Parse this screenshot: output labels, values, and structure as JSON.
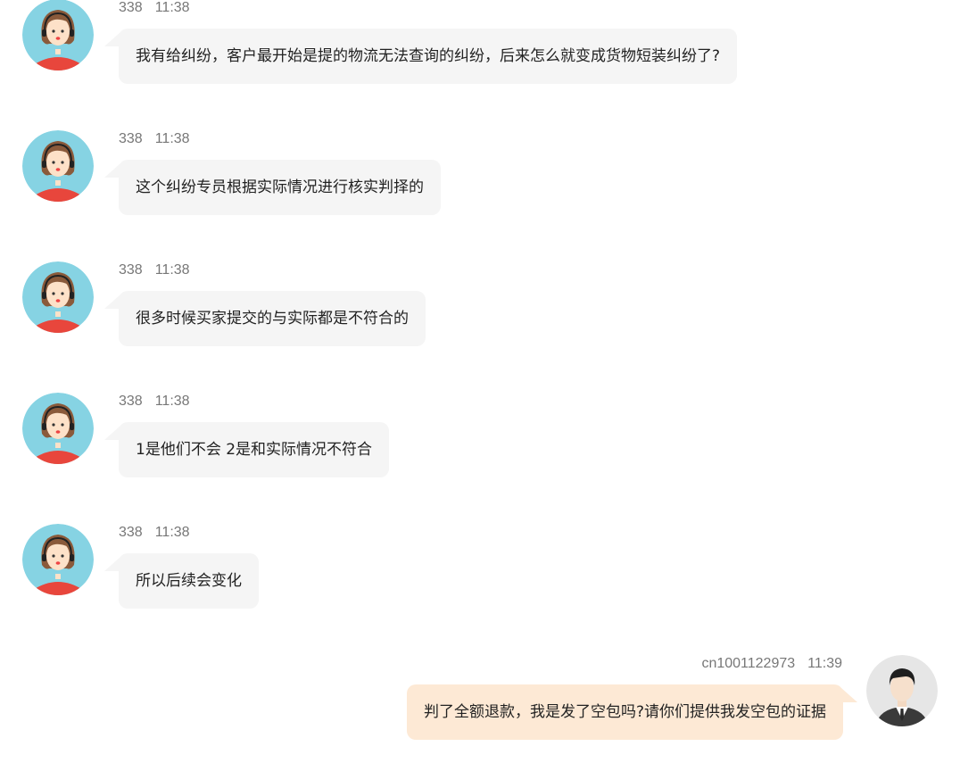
{
  "messages": [
    {
      "role": "agent",
      "sender": "338",
      "time": "11:38",
      "text": "我有给纠纷，客户最开始是提的物流无法查询的纠纷，后来怎么就变成货物短装纠纷了?",
      "avatar": "agent-avatar-icon"
    },
    {
      "role": "agent",
      "sender": "338",
      "time": "11:38",
      "text": "这个纠纷专员根据实际情况进行核实判择的",
      "avatar": "agent-avatar-icon"
    },
    {
      "role": "agent",
      "sender": "338",
      "time": "11:38",
      "text": "很多时候买家提交的与实际都是不符合的",
      "avatar": "agent-avatar-icon"
    },
    {
      "role": "agent",
      "sender": "338",
      "time": "11:38",
      "text": "1是他们不会 2是和实际情况不符合",
      "avatar": "agent-avatar-icon"
    },
    {
      "role": "agent",
      "sender": "338",
      "time": "11:38",
      "text": "所以后续会变化",
      "avatar": "agent-avatar-icon"
    },
    {
      "role": "user",
      "sender": "cn1001122973",
      "time": "11:39",
      "text": "判了全额退款，我是发了空包吗?请你们提供我发空包的证据",
      "avatar": "user-avatar-icon"
    }
  ],
  "colors": {
    "agent_bubble": "#f5f5f5",
    "user_bubble": "#fde9d5",
    "meta_text": "#777777",
    "message_text": "#222222"
  }
}
